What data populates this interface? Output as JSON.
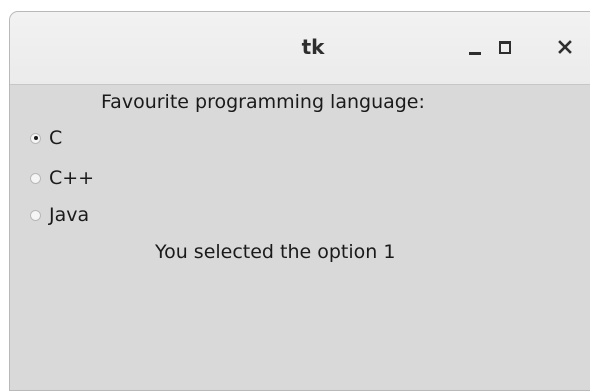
{
  "window": {
    "title": "tk",
    "controls": {
      "minimize": "minimize",
      "maximize": "maximize",
      "close": "×"
    }
  },
  "content": {
    "heading": "Favourite programming language:",
    "options": [
      {
        "label": "C",
        "selected": true
      },
      {
        "label": "C++",
        "selected": false
      },
      {
        "label": "Java",
        "selected": false
      }
    ],
    "result": "You selected the option 1"
  },
  "colors": {
    "background": "#d9d9d9",
    "titlebar": "#eeeeee",
    "text": "#1a1a1a"
  }
}
